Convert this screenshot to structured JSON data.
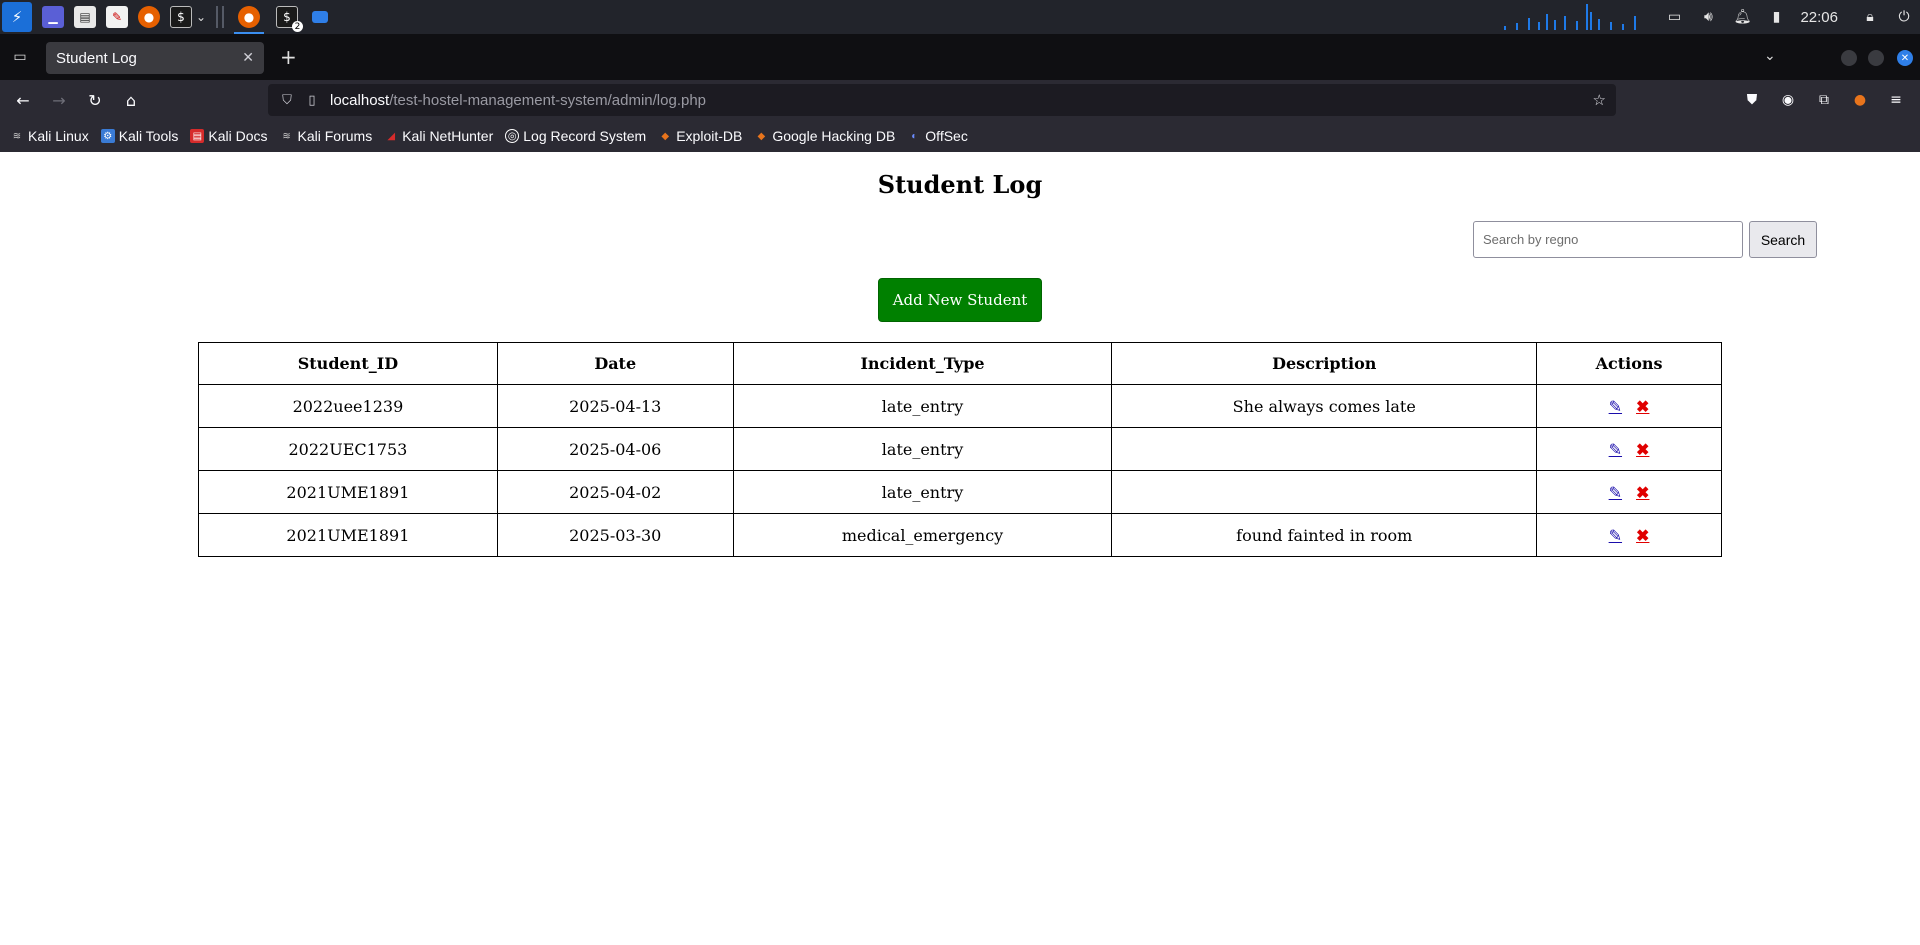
{
  "taskbar": {
    "clock": "22:06",
    "terminal_badge": "2"
  },
  "browser": {
    "tab_title": "Student Log",
    "url_host": "localhost",
    "url_path": "/test-hostel-management-system/admin/log.php"
  },
  "bookmarks": [
    {
      "label": "Kali Linux",
      "color": "#cfcfcf"
    },
    {
      "label": "Kali Tools",
      "color": "#3a7bd5"
    },
    {
      "label": "Kali Docs",
      "color": "#d62b2b"
    },
    {
      "label": "Kali Forums",
      "color": "#cfcfcf"
    },
    {
      "label": "Kali NetHunter",
      "color": "#d62b2b"
    },
    {
      "label": "Log Record System",
      "color": "#ffffff"
    },
    {
      "label": "Exploit-DB",
      "color": "#e8741c"
    },
    {
      "label": "Google Hacking DB",
      "color": "#e8741c"
    },
    {
      "label": "OffSec",
      "color": "#6b8cff"
    }
  ],
  "page": {
    "title": "Student Log",
    "search_placeholder": "Search by regno",
    "search_button": "Search",
    "add_button": "Add New Student",
    "accent_green": "#008000"
  },
  "table": {
    "headers": [
      "Student_ID",
      "Date",
      "Incident_Type",
      "Description",
      "Actions"
    ],
    "rows": [
      {
        "student_id": "2022uee1239",
        "date": "2025-04-13",
        "incident_type": "late_entry",
        "description": "She always comes late"
      },
      {
        "student_id": "2022UEC1753",
        "date": "2025-04-06",
        "incident_type": "late_entry",
        "description": ""
      },
      {
        "student_id": "2021UME1891",
        "date": "2025-04-02",
        "incident_type": "late_entry",
        "description": ""
      },
      {
        "student_id": "2021UME1891",
        "date": "2025-03-30",
        "incident_type": "medical_emergency",
        "description": "found fainted in room"
      }
    ],
    "edit_icon": "✎",
    "delete_icon": "✖"
  }
}
